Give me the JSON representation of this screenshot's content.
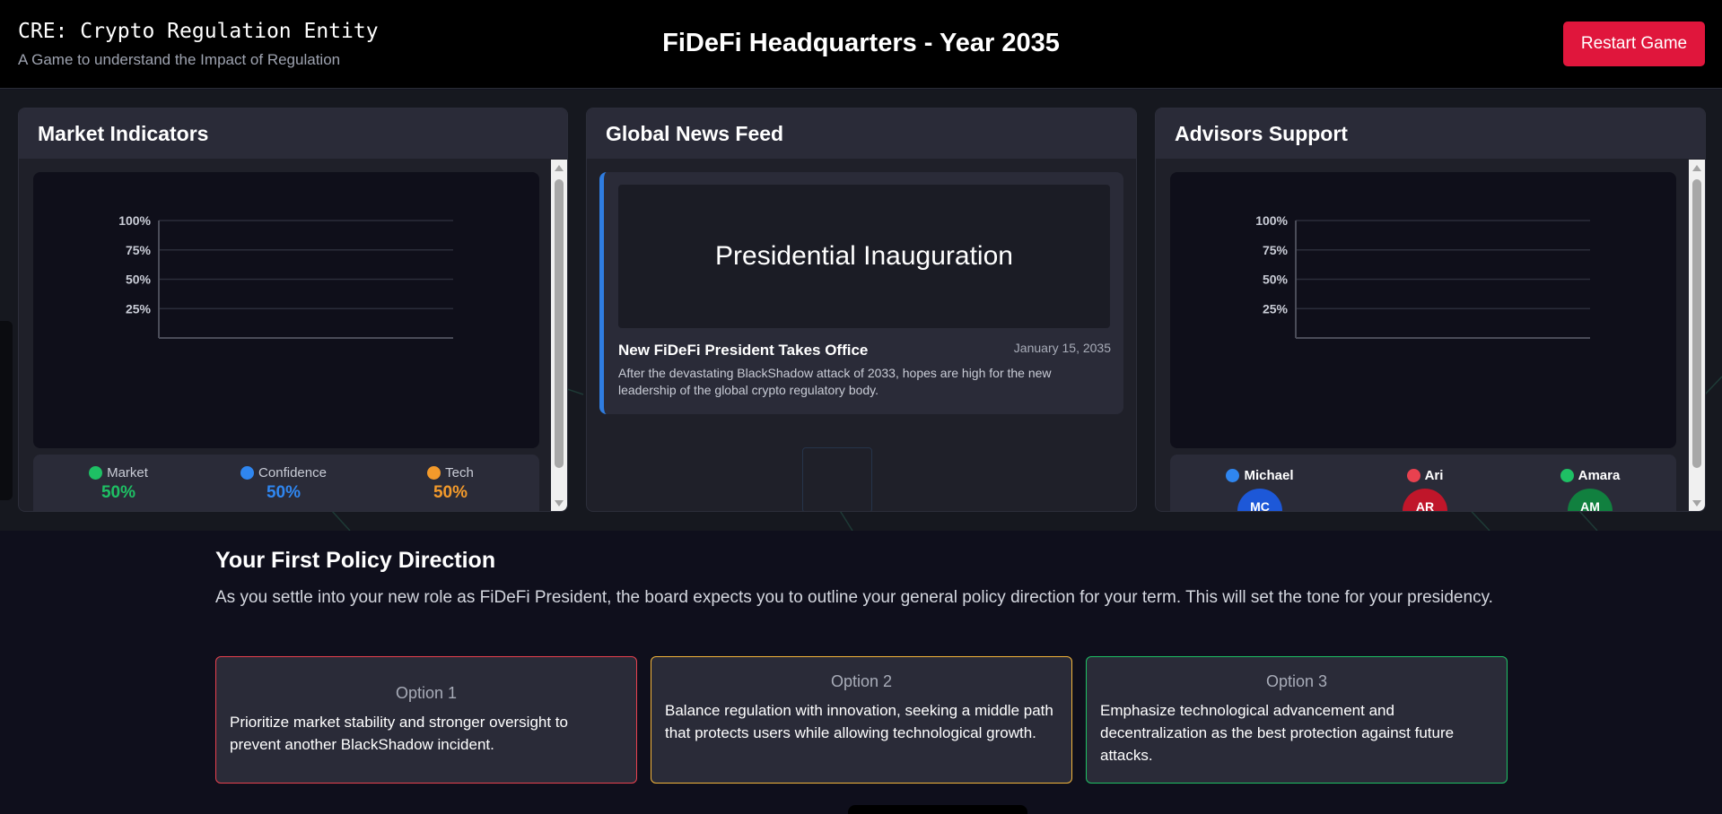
{
  "header": {
    "brand_title": "CRE: Crypto Regulation Entity",
    "brand_subtitle": "A Game to understand the Impact of Regulation",
    "hq_title": "FiDeFi Headquarters - Year 2035",
    "restart_label": "Restart Game"
  },
  "colors": {
    "accent_red": "#e0163c",
    "market": "#1ec064",
    "confidence": "#2f86f0",
    "tech": "#f39a2b",
    "news_accent": "#2f7de1"
  },
  "market_panel": {
    "title": "Market Indicators",
    "indicators": [
      {
        "name": "Market",
        "value": "50%",
        "color": "#1ec064"
      },
      {
        "name": "Confidence",
        "value": "50%",
        "color": "#2f86f0"
      },
      {
        "name": "Tech",
        "value": "50%",
        "color": "#f39a2b"
      }
    ]
  },
  "news_panel": {
    "title": "Global News Feed",
    "item": {
      "banner": "Presidential Inauguration",
      "headline": "New FiDeFi President Takes Office",
      "date": "January 15, 2035",
      "body": "After the devastating BlackShadow attack of 2033, hopes are high for the new leadership of the global crypto regulatory body."
    }
  },
  "advisors_panel": {
    "title": "Advisors Support",
    "advisors": [
      {
        "name": "Michael",
        "initials": "MC",
        "color": "#2f86f0",
        "avatar_color": "#1d58d8"
      },
      {
        "name": "Ari",
        "initials": "AR",
        "color": "#e8414f",
        "avatar_color": "#c0162a"
      },
      {
        "name": "Amara",
        "initials": "AM",
        "color": "#1ec064",
        "avatar_color": "#11803f"
      }
    ]
  },
  "chart_data": [
    {
      "type": "line",
      "title": "",
      "ylabel": "",
      "xlabel": "",
      "y_ticks": [
        "100%",
        "75%",
        "50%",
        "25%"
      ],
      "ylim": [
        0,
        100
      ],
      "grid": true,
      "series": []
    },
    {
      "type": "line",
      "title": "",
      "ylabel": "",
      "xlabel": "",
      "y_ticks": [
        "100%",
        "75%",
        "50%",
        "25%"
      ],
      "ylim": [
        0,
        100
      ],
      "grid": true,
      "series": []
    }
  ],
  "policy": {
    "title": "Your First Policy Direction",
    "description": "As you settle into your new role as FiDeFi President, the board expects you to outline your general policy direction for your term. This will set the tone for your presidency.",
    "options": [
      {
        "label": "Option 1",
        "text": "Prioritize market stability and stronger oversight to prevent another BlackShadow incident.",
        "border": "#e8414f"
      },
      {
        "label": "Option 2",
        "text": "Balance regulation with innovation, seeking a middle path that protects users while allowing technological growth.",
        "border": "#f3b53b"
      },
      {
        "label": "Option 3",
        "text": "Emphasize technological advancement and decentralization as the best protection against future attacks.",
        "border": "#1ec064"
      }
    ]
  }
}
